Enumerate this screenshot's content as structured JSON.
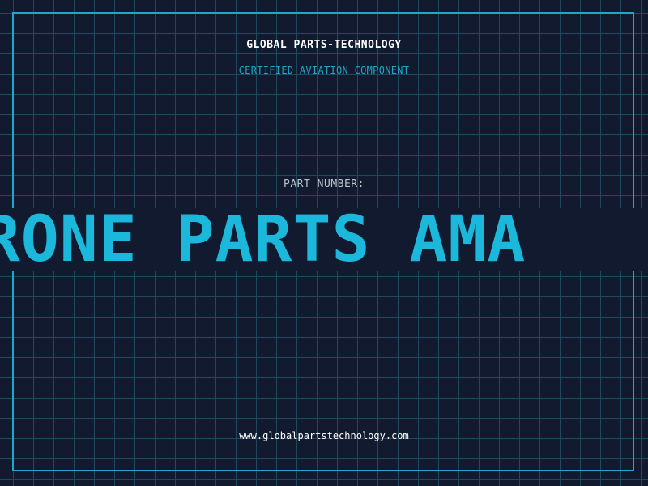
{
  "header": {
    "brand": "GLOBAL PARTS-TECHNOLOGY",
    "subtitle": "CERTIFIED AVIATION COMPONENT"
  },
  "part": {
    "label": "PART NUMBER:",
    "marquee_text": "OP DRONE PARTS AMA"
  },
  "footer": {
    "url": "www.globalpartstechnology.com"
  },
  "colors": {
    "background": "#111a2e",
    "grid": "#1f4a5c",
    "accent": "#1bb8db",
    "text": "#ffffff",
    "muted": "#b9c3cc"
  }
}
